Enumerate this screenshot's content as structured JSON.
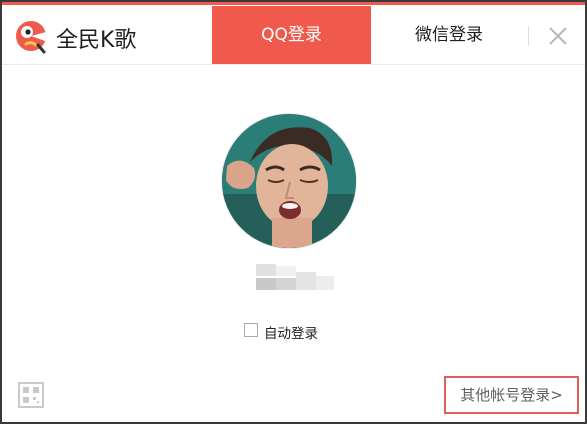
{
  "app": {
    "title": "全民K歌",
    "logo_icon": "kge-logo-icon"
  },
  "tabs": [
    {
      "label": "QQ登录",
      "active": true
    },
    {
      "label": "微信登录",
      "active": false
    }
  ],
  "controls": {
    "close_icon": "close-icon"
  },
  "account": {
    "avatar": "user-avatar-photo",
    "nickname_state": "blurred"
  },
  "auto_login": {
    "label": "自动登录",
    "checked": false
  },
  "footer": {
    "qr_icon": "qr-code-icon",
    "other_login_label": "其他帐号登录>"
  },
  "colors": {
    "accent": "#ef5a4d",
    "highlight_border": "#e05f5a",
    "text_dark": "#1f1f1f",
    "text_muted": "#606060"
  }
}
